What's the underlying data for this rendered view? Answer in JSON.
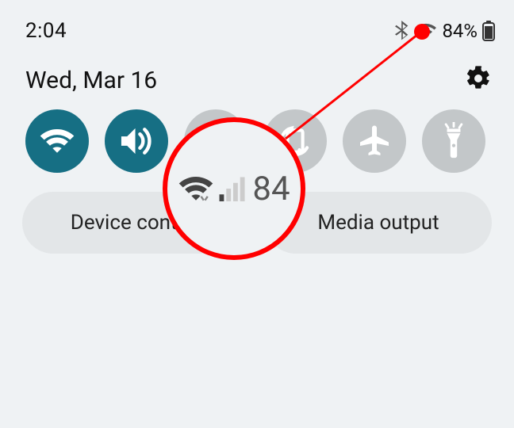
{
  "statusbar": {
    "time": "2:04",
    "battery_pct": "84%"
  },
  "date": "Wed, Mar 16",
  "magnifier": {
    "label": "84"
  },
  "tiles": {
    "wifi": {
      "name": "wifi-tile",
      "active": true
    },
    "sound": {
      "name": "sound-tile",
      "active": true
    },
    "bluetooth": {
      "name": "bluetooth-tile",
      "active": false
    },
    "rotate": {
      "name": "rotate-tile",
      "active": false
    },
    "airplane": {
      "name": "airplane-tile",
      "active": false
    },
    "flashlight": {
      "name": "flashlight-tile",
      "active": false
    }
  },
  "pills": {
    "device_control": "Device control",
    "media_output": "Media output"
  },
  "colors": {
    "tile_on": "#166f84",
    "tile_off": "#c3c7c9",
    "annotation": "#ff0000"
  }
}
